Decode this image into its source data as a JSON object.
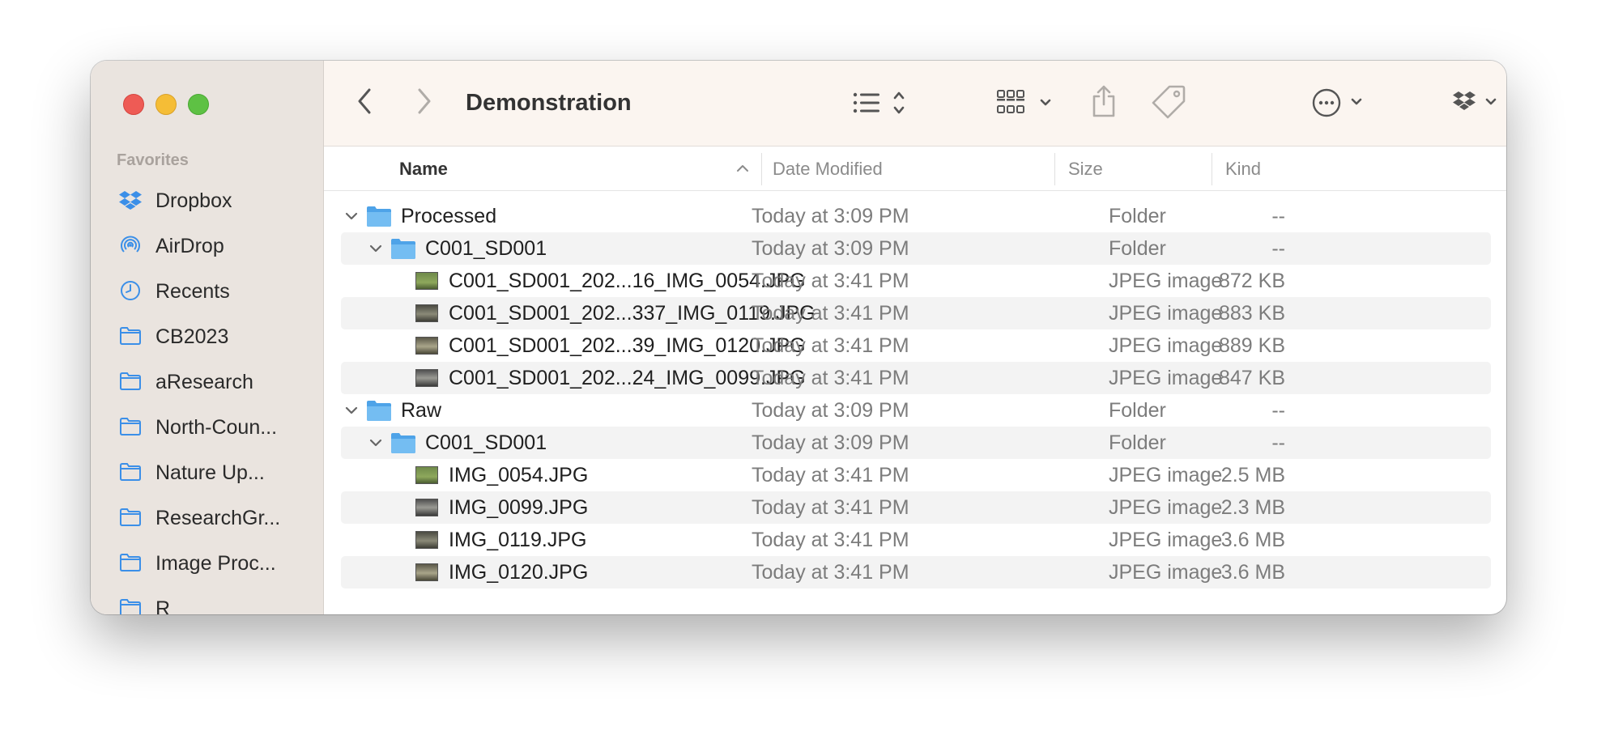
{
  "window": {
    "title": "Demonstration"
  },
  "sidebar": {
    "section_title": "Favorites",
    "items": [
      {
        "label": "Dropbox",
        "icon": "dropbox-icon"
      },
      {
        "label": "AirDrop",
        "icon": "airdrop-icon"
      },
      {
        "label": "Recents",
        "icon": "clock-icon"
      },
      {
        "label": "CB2023",
        "icon": "folder-icon"
      },
      {
        "label": "aResearch",
        "icon": "folder-icon"
      },
      {
        "label": "North-Coun...",
        "icon": "folder-icon"
      },
      {
        "label": "Nature Up...",
        "icon": "folder-icon"
      },
      {
        "label": "ResearchGr...",
        "icon": "folder-icon"
      },
      {
        "label": "Image Proc...",
        "icon": "folder-icon"
      },
      {
        "label": "R",
        "icon": "folder-icon"
      }
    ]
  },
  "columns": {
    "name": "Name",
    "date": "Date Modified",
    "size": "Size",
    "kind": "Kind"
  },
  "rows": [
    {
      "name": "Processed",
      "date": "Today at 3:09 PM",
      "size": "--",
      "kind": "Folder"
    },
    {
      "name": "C001_SD001",
      "date": "Today at 3:09 PM",
      "size": "--",
      "kind": "Folder"
    },
    {
      "name": "C001_SD001_202...16_IMG_0054.JPG",
      "date": "Today at 3:41 PM",
      "size": "872 KB",
      "kind": "JPEG image"
    },
    {
      "name": "C001_SD001_202...337_IMG_0119.JPG",
      "date": "Today at 3:41 PM",
      "size": "883 KB",
      "kind": "JPEG image"
    },
    {
      "name": "C001_SD001_202...39_IMG_0120.JPG",
      "date": "Today at 3:41 PM",
      "size": "889 KB",
      "kind": "JPEG image"
    },
    {
      "name": "C001_SD001_202...24_IMG_0099.JPG",
      "date": "Today at 3:41 PM",
      "size": "847 KB",
      "kind": "JPEG image"
    },
    {
      "name": "Raw",
      "date": "Today at 3:09 PM",
      "size": "--",
      "kind": "Folder"
    },
    {
      "name": "C001_SD001",
      "date": "Today at 3:09 PM",
      "size": "--",
      "kind": "Folder"
    },
    {
      "name": "IMG_0054.JPG",
      "date": "Today at 3:41 PM",
      "size": "2.5 MB",
      "kind": "JPEG image"
    },
    {
      "name": "IMG_0099.JPG",
      "date": "Today at 3:41 PM",
      "size": "2.3 MB",
      "kind": "JPEG image"
    },
    {
      "name": "IMG_0119.JPG",
      "date": "Today at 3:41 PM",
      "size": "3.6 MB",
      "kind": "JPEG image"
    },
    {
      "name": "IMG_0120.JPG",
      "date": "Today at 3:41 PM",
      "size": "3.6 MB",
      "kind": "JPEG image"
    }
  ],
  "colors": {
    "folder_blue": "#6cb4ee",
    "sidebar_icon_blue": "#3b8fe8",
    "close": "#ee5b55",
    "minimize": "#f5bd36",
    "maximize": "#5ec144"
  }
}
